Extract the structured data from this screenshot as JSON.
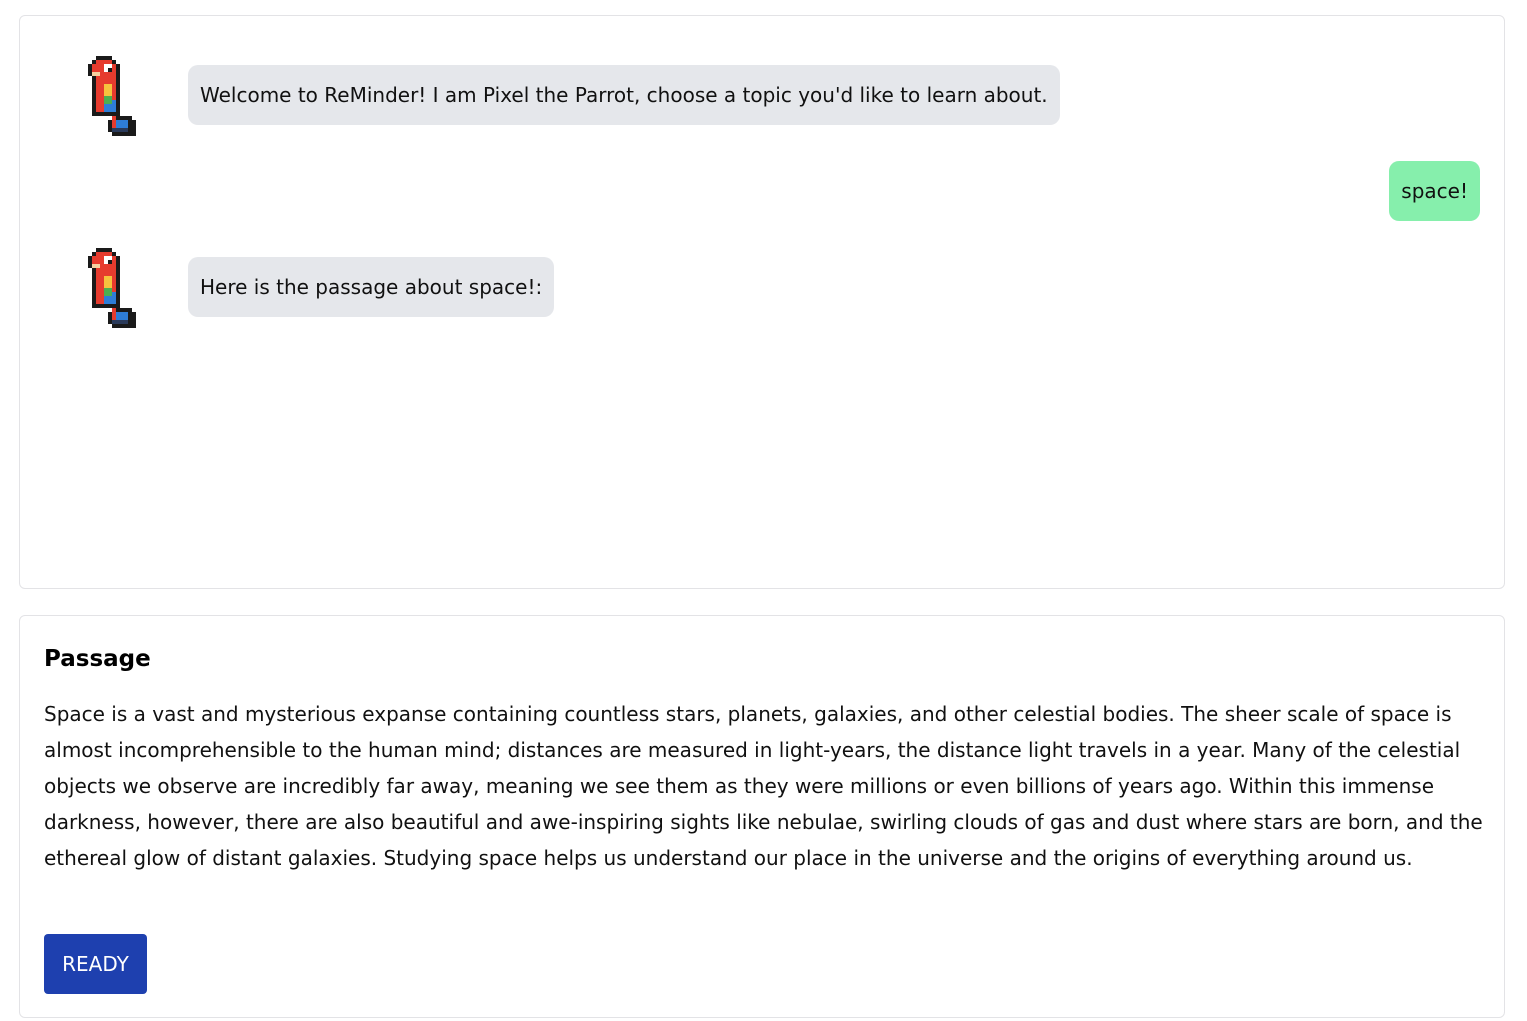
{
  "chat": {
    "messages": [
      {
        "sender": "bot",
        "avatar_icon": "parrot-icon",
        "text": "Welcome to ReMinder! I am Pixel the Parrot, choose a topic you'd like to learn about."
      },
      {
        "sender": "user",
        "text": "space!"
      },
      {
        "sender": "bot",
        "avatar_icon": "parrot-icon",
        "text": "Here is the passage about space!:"
      }
    ]
  },
  "passage": {
    "title": "Passage",
    "text": "Space is a vast and mysterious expanse containing countless stars, planets, galaxies, and other celestial bodies. The sheer scale of space is almost incomprehensible to the human mind; distances are measured in light-years, the distance light travels in a year. Many of the celestial objects we observe are incredibly far away, meaning we see them as they were millions or even billions of years ago. Within this immense darkness, however, there are also beautiful and awe-inspiring sights like nebulae, swirling clouds of gas and dust where stars are born, and the ethereal glow of distant galaxies. Studying space helps us understand our place in the universe and the origins of everything around us.",
    "ready_label": "READY"
  },
  "colors": {
    "bot_bubble": "#e5e7eb",
    "user_bubble": "#86efac",
    "ready_button": "#1e40af"
  }
}
